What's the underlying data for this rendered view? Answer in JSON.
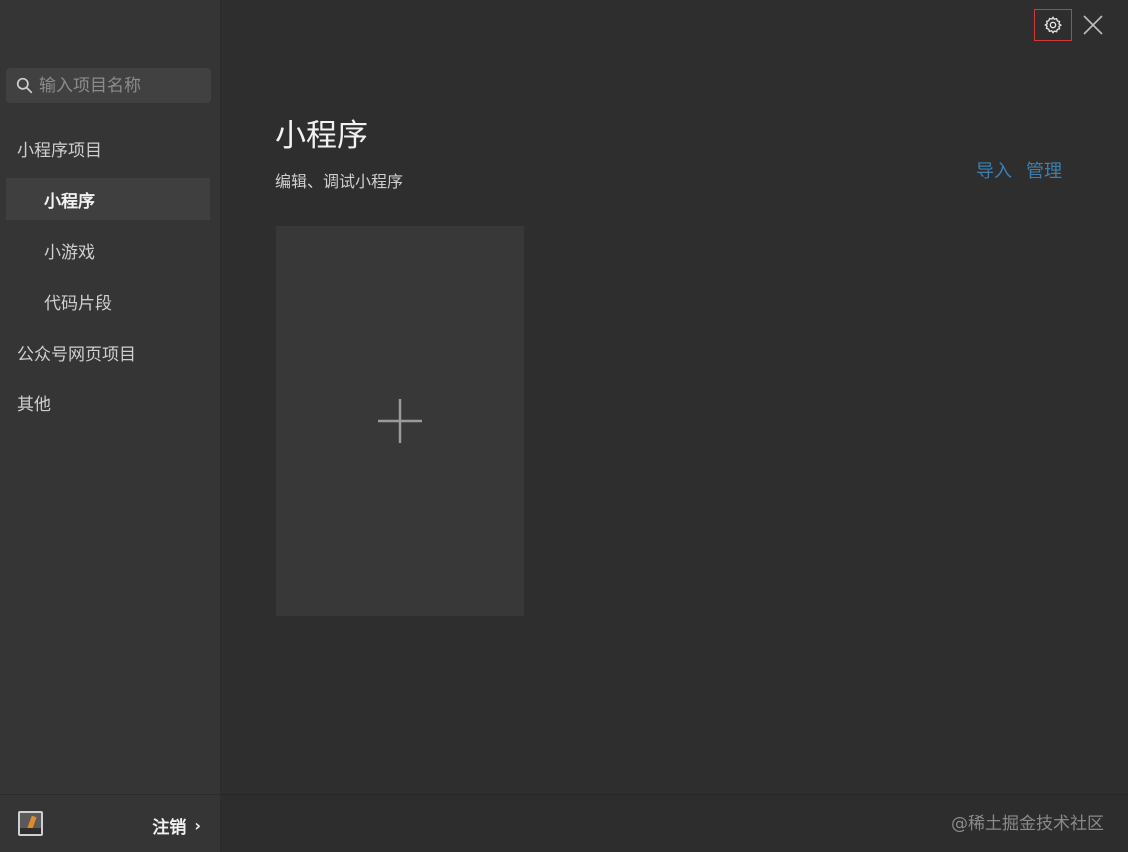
{
  "sidebar": {
    "search": {
      "placeholder": "输入项目名称",
      "icon": "search-icon"
    },
    "items": [
      {
        "label": "小程序项目",
        "kind": "group"
      },
      {
        "label": "小程序",
        "kind": "sub",
        "active": true
      },
      {
        "label": "小游戏",
        "kind": "sub"
      },
      {
        "label": "代码片段",
        "kind": "sub"
      },
      {
        "label": "公众号网页项目",
        "kind": "group"
      },
      {
        "label": "其他",
        "kind": "group"
      }
    ],
    "user": {
      "logout_label": "注销",
      "chevron": "›"
    }
  },
  "main": {
    "title": "小程序",
    "subtitle": "编辑、调试小程序",
    "actions": {
      "import_label": "导入",
      "manage_label": "管理"
    },
    "footer": {
      "watermark": "@稀土掘金技术社区"
    }
  },
  "colors": {
    "accent_link": "#3f7fb0",
    "highlight_border": "#d13a3a",
    "sidebar_bg": "#353535",
    "main_bg": "#2e2e2e"
  }
}
